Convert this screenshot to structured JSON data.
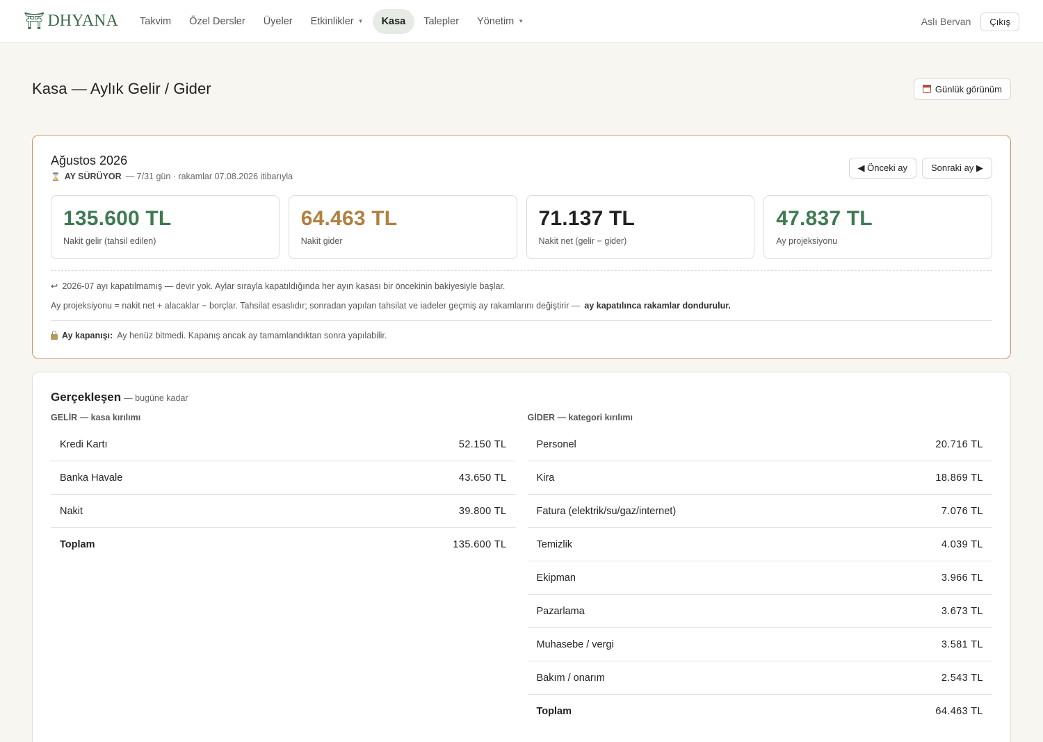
{
  "brand": {
    "name": "DHYANA"
  },
  "nav": {
    "items": [
      {
        "label": "Takvim",
        "caret": false,
        "active": false
      },
      {
        "label": "Özel Dersler",
        "caret": false,
        "active": false
      },
      {
        "label": "Üyeler",
        "caret": false,
        "active": false
      },
      {
        "label": "Etkinlikler",
        "caret": true,
        "active": false
      },
      {
        "label": "Kasa",
        "caret": false,
        "active": true
      },
      {
        "label": "Talepler",
        "caret": false,
        "active": false
      },
      {
        "label": "Yönetim",
        "caret": true,
        "active": false
      }
    ],
    "user_name": "Aslı Bervan",
    "logout_label": "Çıkış"
  },
  "page": {
    "title": "Kasa — Aylık Gelir / Gider",
    "daily_view_label": "Günlük görünüm"
  },
  "month": {
    "title": "Ağustos 2026",
    "status": "AY SÜRÜYOR",
    "status_detail": "— 7/31 gün · rakamlar 07.08.2026 itibarıyla",
    "prev_label": "◀ Önceki ay",
    "next_label": "Sonraki ay ▶",
    "stats": [
      {
        "value": "135.600 TL",
        "label": "Nakit gelir (tahsil edilen)",
        "color": "#3e7a52"
      },
      {
        "value": "64.463 TL",
        "label": "Nakit gider",
        "color": "#b17f3f"
      },
      {
        "value": "71.137 TL",
        "label": "Nakit net (gelir − gider)",
        "color": "#222222"
      },
      {
        "value": "47.837 TL",
        "label": "Ay projeksiyonu",
        "color": "#3e7a52"
      }
    ],
    "carry_note": "2026-07 ayı kapatılmamış — devir yok. Aylar sırayla kapatıldığında her ayın kasası bir öncekinin bakiyesiyle başlar.",
    "projection_note": "Ay projeksiyonu = nakit net + alacaklar − borçlar. Tahsilat esaslıdır; sonradan yapılan tahsilat ve iadeler geçmiş ay rakamlarını değiştirir —",
    "projection_note_bold": "ay kapatılınca rakamlar dondurulur.",
    "closing_label": "Ay kapanışı:",
    "closing_text": "Ay henüz bitmedi. Kapanış ancak ay tamamlandıktan sonra yapılabilir."
  },
  "realized": {
    "title": "Gerçekleşen",
    "subtitle": "— bugüne kadar",
    "income": {
      "heading": "GELİR — kasa kırılımı",
      "rows": [
        {
          "label": "Kredi Kartı",
          "amount": "52.150 TL"
        },
        {
          "label": "Banka Havale",
          "amount": "43.650 TL"
        },
        {
          "label": "Nakit",
          "amount": "39.800 TL"
        }
      ],
      "total_label": "Toplam",
      "total_amount": "135.600 TL"
    },
    "expense": {
      "heading": "GİDER — kategori kırılımı",
      "rows": [
        {
          "label": "Personel",
          "amount": "20.716 TL"
        },
        {
          "label": "Kira",
          "amount": "18.869 TL"
        },
        {
          "label": "Fatura (elektrik/su/gaz/internet)",
          "amount": "7.076 TL"
        },
        {
          "label": "Temizlik",
          "amount": "4.039 TL"
        },
        {
          "label": "Ekipman",
          "amount": "3.966 TL"
        },
        {
          "label": "Pazarlama",
          "amount": "3.673 TL"
        },
        {
          "label": "Muhasebe / vergi",
          "amount": "3.581 TL"
        },
        {
          "label": "Bakım / onarım",
          "amount": "2.543 TL"
        }
      ],
      "total_label": "Toplam",
      "total_amount": "64.463 TL"
    }
  }
}
